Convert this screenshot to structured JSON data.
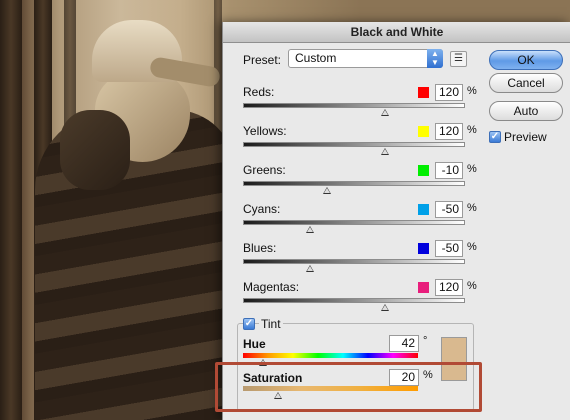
{
  "dialog": {
    "title": "Black and White",
    "preset_label": "Preset:",
    "preset_value": "Custom",
    "buttons": {
      "ok": "OK",
      "cancel": "Cancel",
      "auto": "Auto"
    },
    "preview_label": "Preview",
    "preview_checked": true,
    "sliders": [
      {
        "label": "Reds:",
        "value": "120",
        "unit": "%",
        "color": "#ff0000",
        "position": 0.64
      },
      {
        "label": "Yellows:",
        "value": "120",
        "unit": "%",
        "color": "#ffff00",
        "position": 0.64
      },
      {
        "label": "Greens:",
        "value": "-10",
        "unit": "%",
        "color": "#00ee00",
        "position": 0.38
      },
      {
        "label": "Cyans:",
        "value": "-50",
        "unit": "%",
        "color": "#00a0e8",
        "position": 0.3
      },
      {
        "label": "Blues:",
        "value": "-50",
        "unit": "%",
        "color": "#0000dd",
        "position": 0.3
      },
      {
        "label": "Magentas:",
        "value": "120",
        "unit": "%",
        "color": "#e81e7c",
        "position": 0.64
      }
    ],
    "tint": {
      "label": "Tint",
      "checked": true,
      "hue_label": "Hue",
      "hue_value": "42",
      "hue_unit": "°",
      "saturation_label": "Saturation",
      "saturation_value": "20",
      "saturation_unit": "%",
      "swatch_color": "#d9b98f"
    }
  }
}
